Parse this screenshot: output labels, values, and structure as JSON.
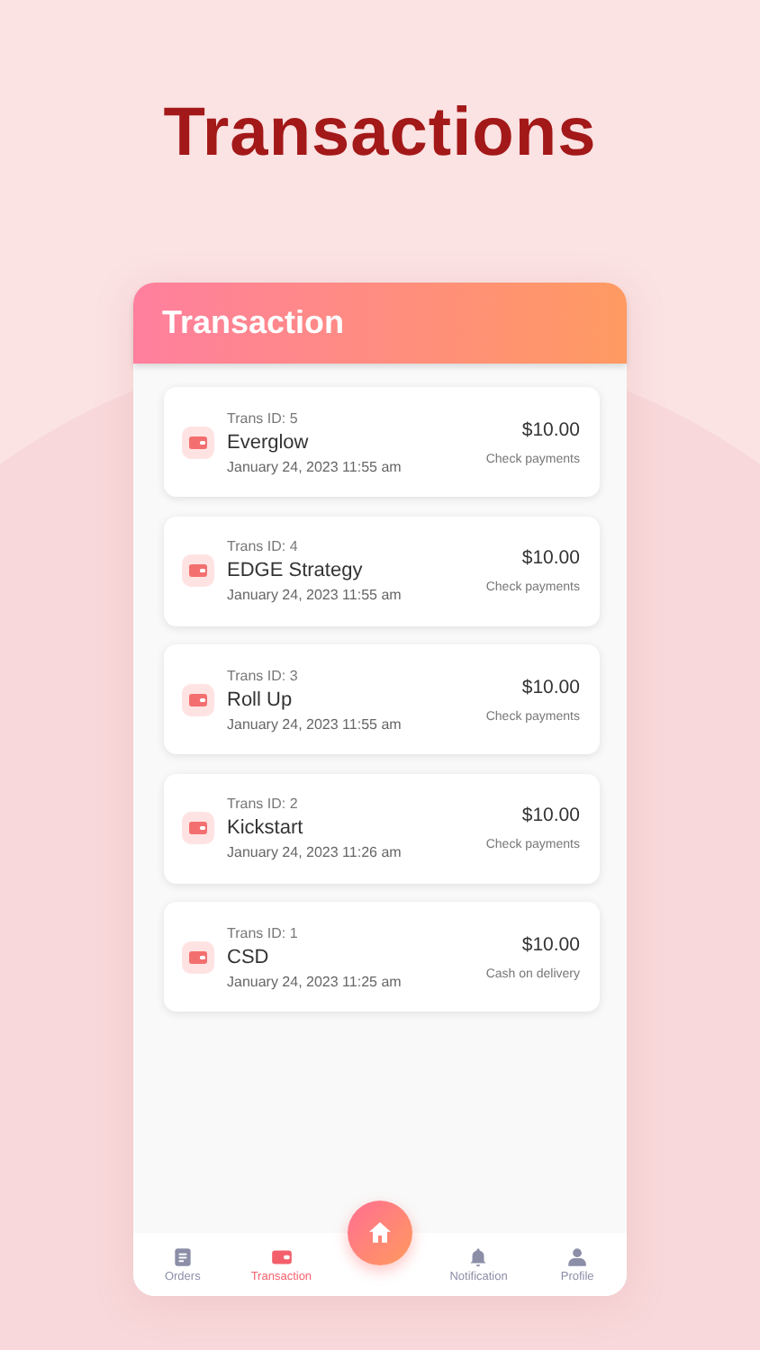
{
  "headline": "Transactions",
  "screen": {
    "title": "Transaction",
    "transactions": [
      {
        "trans_id": "Trans ID: 5",
        "name": "Everglow",
        "date": "January 24, 2023 11:55 am",
        "amount": "$10.00",
        "method": "Check payments"
      },
      {
        "trans_id": "Trans ID: 4",
        "name": "EDGE Strategy",
        "date": "January 24, 2023 11:55 am",
        "amount": "$10.00",
        "method": "Check payments"
      },
      {
        "trans_id": "Trans ID: 3",
        "name": "Roll Up",
        "date": "January 24, 2023 11:55 am",
        "amount": "$10.00",
        "method": "Check payments"
      },
      {
        "trans_id": "Trans ID: 2",
        "name": "Kickstart",
        "date": "January 24, 2023 11:26 am",
        "amount": "$10.00",
        "method": "Check payments"
      },
      {
        "trans_id": "Trans ID: 1",
        "name": "CSD",
        "date": "January 24, 2023 11:25 am",
        "amount": "$10.00",
        "method": "Cash on delivery"
      }
    ],
    "nav": [
      {
        "label": "Orders",
        "kind": "document",
        "selected": false
      },
      {
        "label": "Transaction",
        "kind": "wallet",
        "selected": true
      },
      {
        "kind": "home",
        "selected": false
      },
      {
        "label": "Notification",
        "kind": "bell",
        "selected": false
      },
      {
        "label": "Profile",
        "kind": "person",
        "selected": false
      }
    ]
  }
}
